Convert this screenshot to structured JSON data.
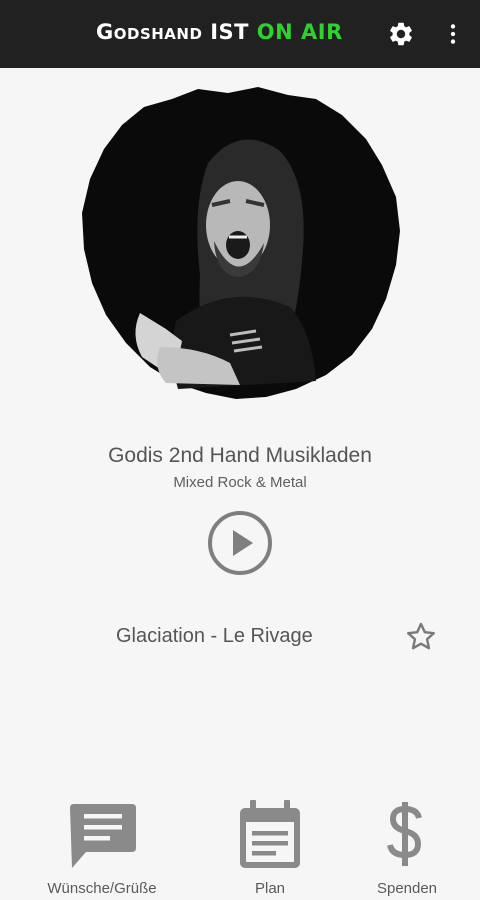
{
  "header": {
    "title_prefix": "Godshand IST",
    "title_highlight": "ON AIR",
    "accent_color": "#2fd12f",
    "background_color": "#212121",
    "settings_icon": "gear-icon",
    "menu_icon": "more-vert-icon"
  },
  "station": {
    "name": "Godis 2nd Hand Musikladen",
    "genre": "Mixed Rock & Metal"
  },
  "player": {
    "play_icon": "play-circle-icon",
    "now_playing": "Glaciation - Le Rivage",
    "favorite_icon": "star-outline-icon"
  },
  "bottom_nav": [
    {
      "label": "Wünsche/Grüße",
      "icon": "chat-icon"
    },
    {
      "label": "Plan",
      "icon": "calendar-icon"
    },
    {
      "label": "Spenden",
      "icon": "dollar-icon"
    }
  ]
}
